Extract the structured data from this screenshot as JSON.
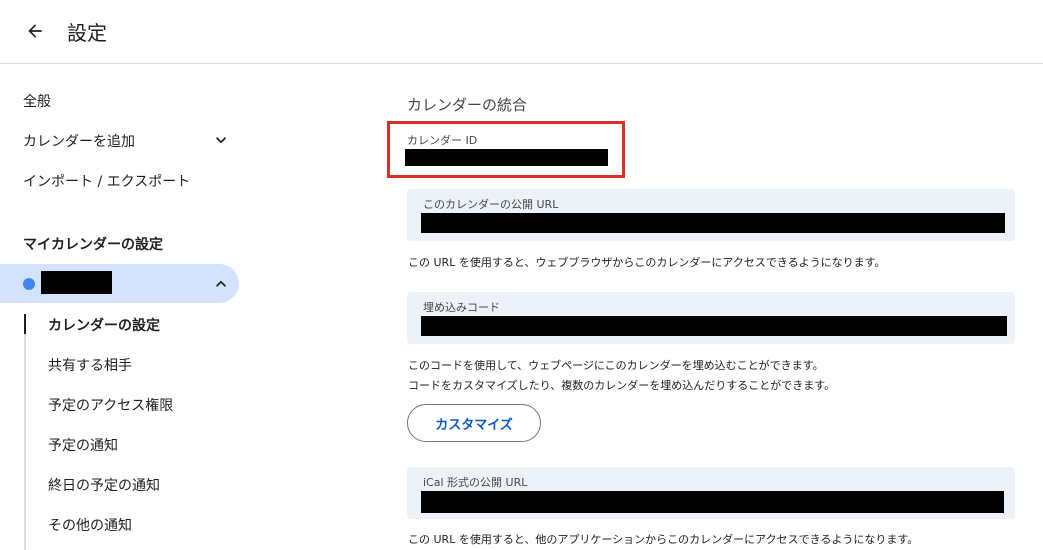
{
  "header": {
    "title": "設定"
  },
  "sidebar": {
    "general": "全般",
    "add_calendar": "カレンダーを追加",
    "import_export": "インポート / エクスポート",
    "my_calendars_heading": "マイカレンダーの設定",
    "calendar_dot_color": "#4285f4",
    "sub_items": [
      "カレンダーの設定",
      "共有する相手",
      "予定のアクセス権限",
      "予定の通知",
      "終日の予定の通知",
      "その他の通知"
    ]
  },
  "main": {
    "section_title": "カレンダーの統合",
    "calendar_id_label": "カレンダー ID",
    "public_url_label": "このカレンダーの公開 URL",
    "public_url_note": "この URL を使用すると、ウェブブラウザからこのカレンダーにアクセスできるようになります。",
    "embed_label": "埋め込みコード",
    "embed_note_1": "このコードを使用して、ウェブページにこのカレンダーを埋め込むことができます。",
    "embed_note_2": "コードをカスタマイズしたり、複数のカレンダーを埋め込んだりすることができます。",
    "customize_button": "カスタマイズ",
    "ical_label": "iCal 形式の公開 URL",
    "ical_note": "この URL を使用すると、他のアプリケーションからこのカレンダーにアクセスできるようになります。"
  },
  "colors": {
    "highlight": "#d93025",
    "accent": "#0b57d0",
    "selected_bg": "#d3e3fd"
  }
}
